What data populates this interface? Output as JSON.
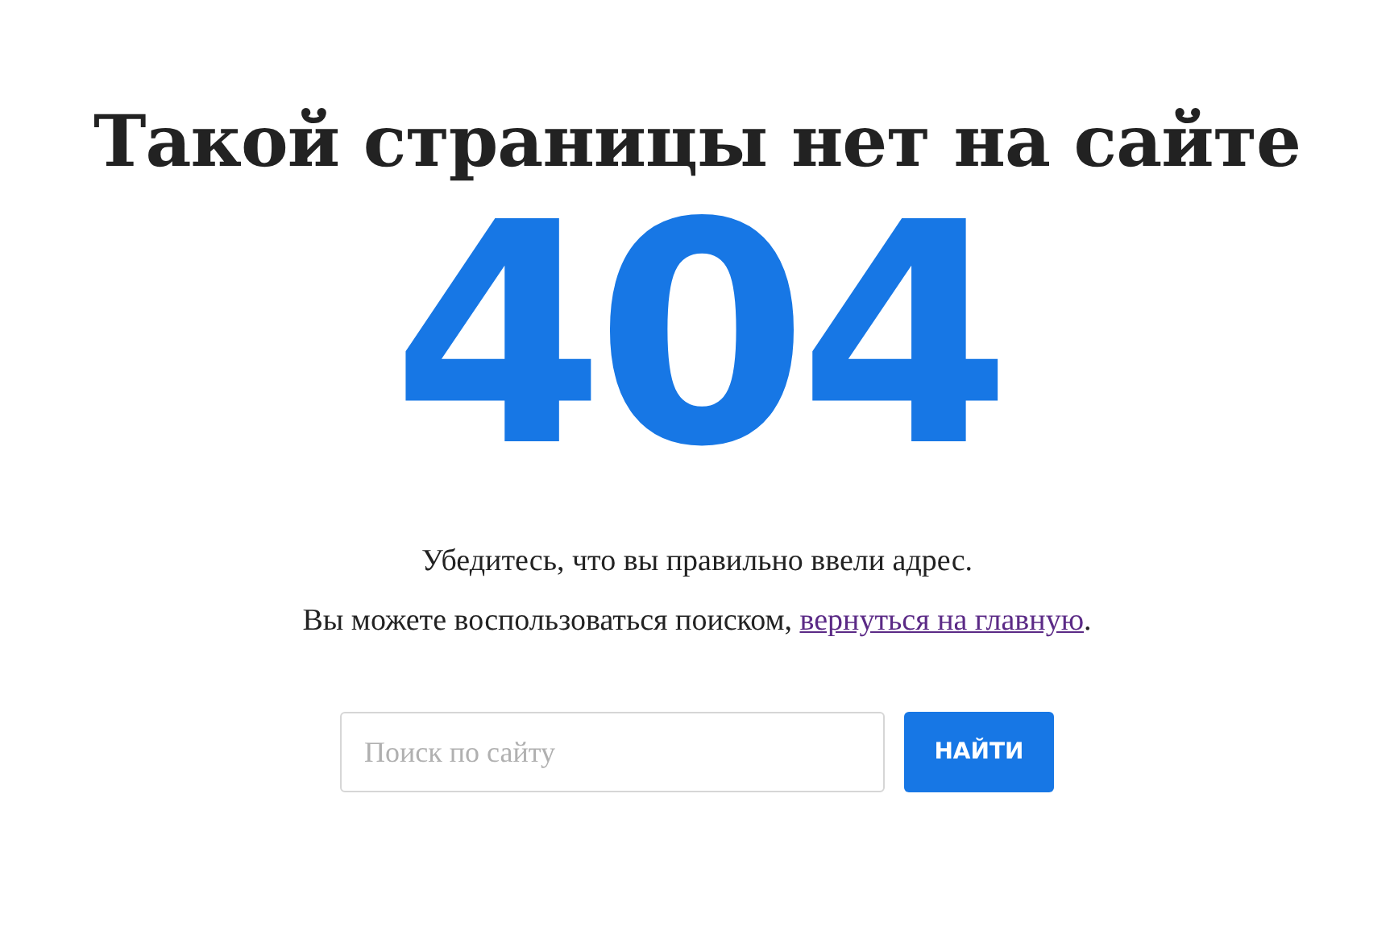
{
  "title": "Такой страницы нет на сайте",
  "code": "404",
  "messages": [
    {
      "text": "Убедитесь, что вы правильно ввели адрес."
    },
    {
      "before": "Вы можете воспользоваться поиском, ",
      "link": "вернуться на главную",
      "after": "."
    }
  ],
  "search": {
    "placeholder": "Поиск по сайту",
    "button": "НАЙТИ"
  }
}
